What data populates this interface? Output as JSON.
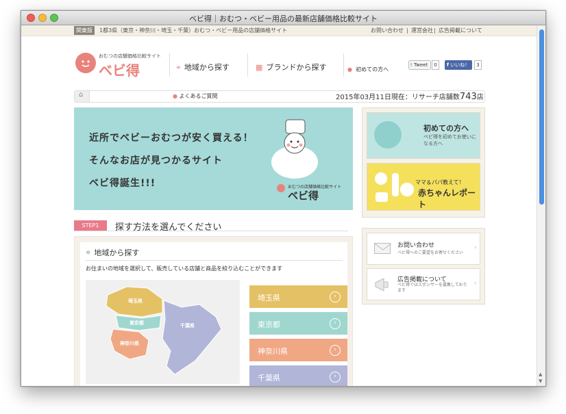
{
  "window": {
    "title": "ベビ得｜おむつ・ベビー用品の最新店舗価格比較サイト"
  },
  "topbar": {
    "badge": "関東版",
    "tagline": "1都3県（東京・神奈川・埼玉・千葉）おむつ・ベビー用品の店舗価格サイト",
    "links": [
      "お問い合わせ",
      "運営会社",
      "広告掲載について"
    ],
    "separator": "|"
  },
  "header": {
    "logo_sub": "おむつの店舗価格比較サイト",
    "logo_main": "ベビ得",
    "nav": {
      "area": "地域から探す",
      "brand": "ブランドから探す",
      "first": "初めての方へ"
    },
    "social": {
      "tweet": "Tweet",
      "tweet_count": "0",
      "like": "いいね！",
      "like_count": "3"
    }
  },
  "infobar": {
    "faq": "よくあるご質問",
    "status_prefix": "2015年03月11日現在：リサーチ店舗数",
    "store_count": "743",
    "status_suffix": "店"
  },
  "hero": {
    "lines": [
      "近所でベビーおむつが安く買える！",
      "そんなお店が見つかるサイト",
      "ベビ得誕生!!!"
    ],
    "logo_sub": "おむつの店舗価格比較サイト",
    "logo_main": "ベビ得"
  },
  "side_cards": {
    "first": {
      "title": "初めての方へ",
      "desc": "ベビ得を初めてお使いになる方へ"
    },
    "report": {
      "title_line1": "ママ＆パパ教えて！",
      "title_line2": "赤ちゃんレポート"
    }
  },
  "step": {
    "badge": "STEP1",
    "title": "探す方法を選んでください"
  },
  "region": {
    "title": "地域から探す",
    "description": "お住まいの地域を選択して、販売している店舗と商品を絞り込むことができます",
    "map_labels": {
      "saitama": "埼玉県",
      "tokyo": "東京都",
      "kanagawa": "神奈川県",
      "chiba": "千葉県"
    },
    "buttons": [
      {
        "label": "埼玉県",
        "color": "#e5c165"
      },
      {
        "label": "東京都",
        "color": "#9fd7cf"
      },
      {
        "label": "神奈川県",
        "color": "#f0a784"
      },
      {
        "label": "千葉県",
        "color": "#b1b5d8"
      }
    ]
  },
  "contact_cards": {
    "contact": {
      "title": "お問い合わせ",
      "desc": "ベビ得へのご要望をお寄せください"
    },
    "ads": {
      "title": "広告掲載について",
      "desc": "ベビ得ではスポンサーを募集しております"
    }
  },
  "colors": {
    "accent": "#e8837c",
    "scroll": "#4a90e0",
    "step": "#e97a8a"
  }
}
